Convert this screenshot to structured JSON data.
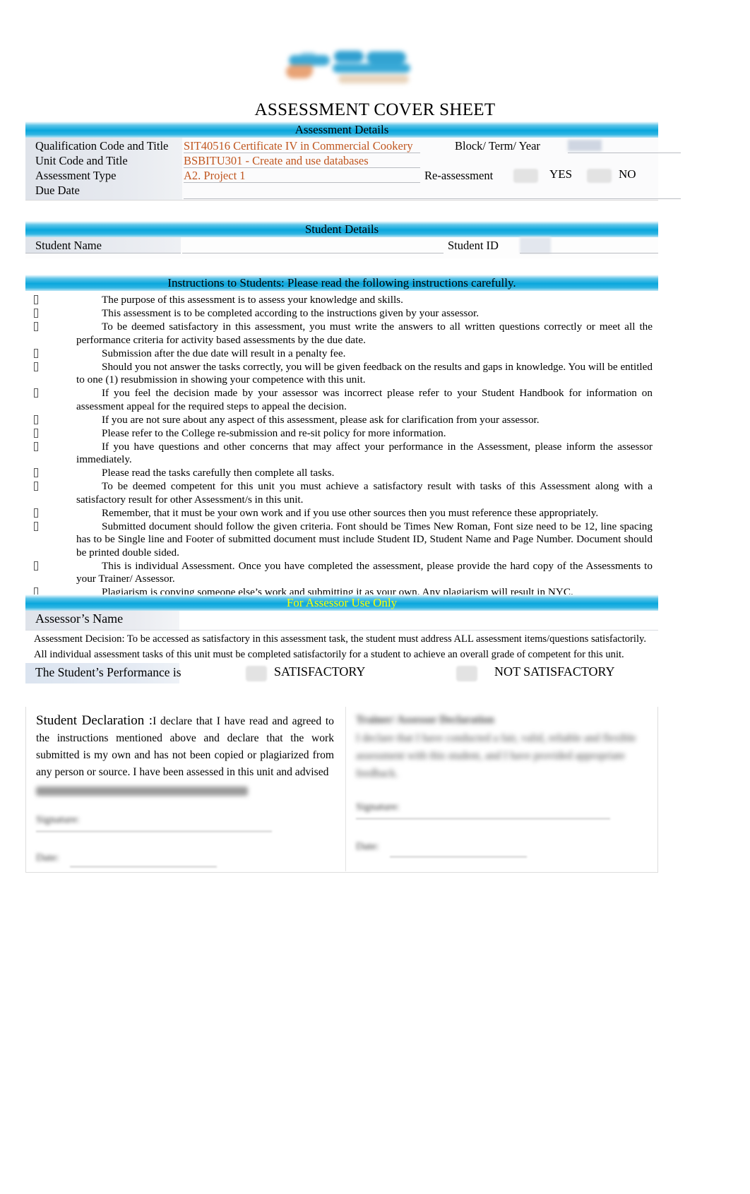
{
  "document": {
    "title": "ASSESSMENT COVER SHEET",
    "logo_alt": "college-logo"
  },
  "assessment_details": {
    "band_title": "Assessment Details",
    "labels": {
      "qualification": "Qualification Code and Title",
      "unit": "Unit Code and Title",
      "assessment_type": "Assessment Type",
      "due_date": "Due Date",
      "block_term_year": "Block/ Term/ Year",
      "re_assessment": "Re-assessment"
    },
    "values": {
      "qualification": "SIT40516 Certificate IV in Commercial Cookery",
      "unit": "BSBITU301 - Create and use databases",
      "assessment_type": "A2. Project 1",
      "due_date": "",
      "block_term_year": ""
    },
    "reassessment_options": {
      "yes": "YES",
      "no": "NO"
    }
  },
  "student_details": {
    "band_title": "Student Details",
    "student_name_label": "Student Name",
    "student_name_value": "",
    "student_id_label": "Student ID",
    "student_id_value": ""
  },
  "instructions": {
    "band_title": "Instructions to Students:   Please read the following instructions carefully.",
    "items": [
      "The purpose of this assessment is to assess your knowledge and skills.",
      "This assessment is to be completed according to the instructions given by your assessor.",
      "To be deemed satisfactory in this assessment, you must write the answers to all written questions correctly or meet all the performance criteria for activity based assessments by the due date.",
      "Submission after the due date will result in a penalty fee.",
      "Should you not answer the tasks correctly, you will be given feedback on the results and gaps in knowledge. You will be entitled to one (1) resubmission in showing your competence with this unit.",
      "If you feel the decision made by your assessor was incorrect please refer to your Student Handbook for information on assessment appeal for the required steps to appeal the decision.",
      "If you are not sure about any aspect of this assessment, please ask for clarification from your assessor.",
      "Please refer to the College re-submission and re-sit policy for more information.",
      "If you have questions and other concerns that may affect your performance in the Assessment, please inform the assessor immediately.",
      "Please read the tasks carefully then complete all tasks.",
      "To be deemed competent for this unit you must achieve a satisfactory result with tasks of this Assessment along with a satisfactory result for other Assessment/s in this unit.",
      "Remember, that it must be your own work and if you use other sources then you must reference these appropriately.",
      "Submitted document should follow the given criteria. Font should be Times New Roman, Font size need to be 12, line spacing has to be Single line and Footer of submitted document must include Student ID, Student Name and Page Number. Document should be printed double sided.",
      "This is individual Assessment. Once you have completed the assessment, please provide the hard copy of the Assessments to your Trainer/ Assessor.",
      "Plagiarism is copying someone else’s work and submitting it as your own. Any plagiarism will result in NYC."
    ]
  },
  "assessor_section": {
    "band_title": "For Assessor Use Only",
    "assessor_name_label": "Assessor’s Name",
    "assessor_name_value": "",
    "decision_line_1": "Assessment Decision: To be accessed as satisfactory in this assessment task, the student must address ALL assessment items/questions satisfactorily.",
    "decision_line_2": "All individual assessment tasks of this unit must be completed satisfactorily for a student to achieve an overall grade of competent for this unit.",
    "performance_label": "The Student’s Performance is",
    "performance_options": {
      "satisfactory": "SATISFACTORY",
      "not_satisfactory": "NOT SATISFACTORY"
    }
  },
  "declaration": {
    "student": {
      "title": "Student Declaration",
      "colon": " :",
      "text": "I declare that I have read and agreed to the instructions mentioned above and declare that the work submitted is my own and has not been copied or plagiarized from any person or source. I have been assessed in this unit and advised",
      "signature_label": "Signature:",
      "date_label": "Date:"
    },
    "assessor": {
      "title": "Trainer/ Assessor Declaration",
      "text": "I declare that I have conducted a fair, valid, reliable and flexible assessment with this student, and I have provided appropriate feedback.",
      "signature_label": "Signature:",
      "date_label": "Date:"
    }
  },
  "colors": {
    "band_blue": "#09a7dd",
    "value_orange": "#c0561f",
    "assessor_band_text": "#ffff00",
    "label_fill": "#dfe3ea"
  }
}
